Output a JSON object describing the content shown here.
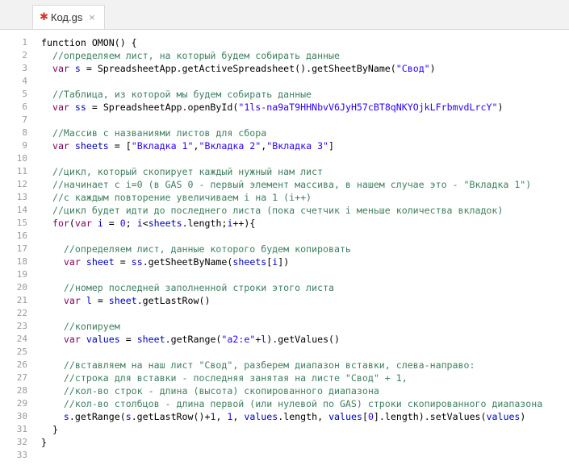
{
  "tab": {
    "modified_marker": "✱",
    "title": "Код.gs",
    "close_label": "×"
  },
  "line_numbers": [
    "1",
    "2",
    "3",
    "4",
    "5",
    "6",
    "7",
    "8",
    "9",
    "10",
    "11",
    "12",
    "13",
    "14",
    "15",
    "16",
    "17",
    "18",
    "19",
    "20",
    "21",
    "22",
    "23",
    "24",
    "25",
    "26",
    "27",
    "28",
    "29",
    "30",
    "31",
    "32",
    "33"
  ],
  "code": [
    [
      {
        "t": "function OMON() {",
        "c": "f"
      }
    ],
    [
      {
        "t": "  //определяем лист, на который будем собирать данные",
        "c": "c"
      }
    ],
    [
      {
        "t": "  ",
        "c": "f"
      },
      {
        "t": "var",
        "c": "k"
      },
      {
        "t": " ",
        "c": "f"
      },
      {
        "t": "s",
        "c": "v"
      },
      {
        "t": " = SpreadsheetApp.getActiveSpreadsheet().getSheetByName(",
        "c": "f"
      },
      {
        "t": "\"Свод\"",
        "c": "s"
      },
      {
        "t": ")",
        "c": "f"
      }
    ],
    [
      {
        "t": "",
        "c": "f"
      }
    ],
    [
      {
        "t": "  //Таблица, из которой мы будем собирать данные",
        "c": "c"
      }
    ],
    [
      {
        "t": "  ",
        "c": "f"
      },
      {
        "t": "var",
        "c": "k"
      },
      {
        "t": " ",
        "c": "f"
      },
      {
        "t": "ss",
        "c": "v"
      },
      {
        "t": " = SpreadsheetApp.openById(",
        "c": "f"
      },
      {
        "t": "\"1ls-na9aT9HHNbvV6JyH57cBT8qNKYOjkLFrbmvdLrcY\"",
        "c": "s"
      },
      {
        "t": ")",
        "c": "f"
      }
    ],
    [
      {
        "t": "",
        "c": "f"
      }
    ],
    [
      {
        "t": "  //Массив с названиями листов для сбора",
        "c": "c"
      }
    ],
    [
      {
        "t": "  ",
        "c": "f"
      },
      {
        "t": "var",
        "c": "k"
      },
      {
        "t": " ",
        "c": "f"
      },
      {
        "t": "sheets",
        "c": "v"
      },
      {
        "t": " = [",
        "c": "f"
      },
      {
        "t": "\"Вкладка 1\"",
        "c": "s"
      },
      {
        "t": ",",
        "c": "f"
      },
      {
        "t": "\"Вкладка 2\"",
        "c": "s"
      },
      {
        "t": ",",
        "c": "f"
      },
      {
        "t": "\"Вкладка 3\"",
        "c": "s"
      },
      {
        "t": "]",
        "c": "f"
      }
    ],
    [
      {
        "t": "",
        "c": "f"
      }
    ],
    [
      {
        "t": "  //цикл, который скопирует каждый нужный нам лист",
        "c": "c"
      }
    ],
    [
      {
        "t": "  //начинает с i=0 (в GAS 0 - первый элемент массива, в нашем случае это - \"Вкладка 1\")",
        "c": "c"
      }
    ],
    [
      {
        "t": "  //с каждым повторение увеличиваем i на 1 (i++)",
        "c": "c"
      }
    ],
    [
      {
        "t": "  //цикл будет идти до последнего листа (пока счетчик i меньше количества вкладок)",
        "c": "c"
      }
    ],
    [
      {
        "t": "  ",
        "c": "f"
      },
      {
        "t": "for",
        "c": "k"
      },
      {
        "t": "(",
        "c": "f"
      },
      {
        "t": "var",
        "c": "k"
      },
      {
        "t": " ",
        "c": "f"
      },
      {
        "t": "i",
        "c": "v"
      },
      {
        "t": " = ",
        "c": "f"
      },
      {
        "t": "0",
        "c": "s"
      },
      {
        "t": "; ",
        "c": "f"
      },
      {
        "t": "i",
        "c": "v"
      },
      {
        "t": "<",
        "c": "f"
      },
      {
        "t": "sheets",
        "c": "v"
      },
      {
        "t": ".length;",
        "c": "f"
      },
      {
        "t": "i",
        "c": "v"
      },
      {
        "t": "++){",
        "c": "f"
      }
    ],
    [
      {
        "t": "",
        "c": "f"
      }
    ],
    [
      {
        "t": "    //определяем лист, данные которого будем копировать",
        "c": "c"
      }
    ],
    [
      {
        "t": "    ",
        "c": "f"
      },
      {
        "t": "var",
        "c": "k"
      },
      {
        "t": " ",
        "c": "f"
      },
      {
        "t": "sheet",
        "c": "v"
      },
      {
        "t": " = ",
        "c": "f"
      },
      {
        "t": "ss",
        "c": "v"
      },
      {
        "t": ".getSheetByName(",
        "c": "f"
      },
      {
        "t": "sheets",
        "c": "v"
      },
      {
        "t": "[",
        "c": "f"
      },
      {
        "t": "i",
        "c": "v"
      },
      {
        "t": "])",
        "c": "f"
      }
    ],
    [
      {
        "t": "",
        "c": "f"
      }
    ],
    [
      {
        "t": "    //номер последней заполненной строки этого листа",
        "c": "c"
      }
    ],
    [
      {
        "t": "    ",
        "c": "f"
      },
      {
        "t": "var",
        "c": "k"
      },
      {
        "t": " ",
        "c": "f"
      },
      {
        "t": "l",
        "c": "v"
      },
      {
        "t": " = ",
        "c": "f"
      },
      {
        "t": "sheet",
        "c": "v"
      },
      {
        "t": ".getLastRow()",
        "c": "f"
      }
    ],
    [
      {
        "t": "",
        "c": "f"
      }
    ],
    [
      {
        "t": "    //копируем",
        "c": "c"
      }
    ],
    [
      {
        "t": "    ",
        "c": "f"
      },
      {
        "t": "var",
        "c": "k"
      },
      {
        "t": " ",
        "c": "f"
      },
      {
        "t": "values",
        "c": "v"
      },
      {
        "t": " = ",
        "c": "f"
      },
      {
        "t": "sheet",
        "c": "v"
      },
      {
        "t": ".getRange(",
        "c": "f"
      },
      {
        "t": "\"a2:e\"",
        "c": "s"
      },
      {
        "t": "+",
        "c": "f"
      },
      {
        "t": "l",
        "c": "v"
      },
      {
        "t": ").getValues()",
        "c": "f"
      }
    ],
    [
      {
        "t": "",
        "c": "f"
      }
    ],
    [
      {
        "t": "    //вставляем на наш лист \"Свод\", разберем диапазон вставки, слева-направо:",
        "c": "c"
      }
    ],
    [
      {
        "t": "    //строка для вставки - последняя занятая на листе \"Свод\" + 1,",
        "c": "c"
      }
    ],
    [
      {
        "t": "    //кол-во строк - длина (высота) скопированного диапазона",
        "c": "c"
      }
    ],
    [
      {
        "t": "    //кол-во столбцов - длина первой (или нулевой по GAS) строки скопированного диапазона",
        "c": "c"
      }
    ],
    [
      {
        "t": "    ",
        "c": "f"
      },
      {
        "t": "s",
        "c": "v"
      },
      {
        "t": ".getRange(",
        "c": "f"
      },
      {
        "t": "s",
        "c": "v"
      },
      {
        "t": ".getLastRow()+",
        "c": "f"
      },
      {
        "t": "1",
        "c": "s"
      },
      {
        "t": ", ",
        "c": "f"
      },
      {
        "t": "1",
        "c": "s"
      },
      {
        "t": ", ",
        "c": "f"
      },
      {
        "t": "values",
        "c": "v"
      },
      {
        "t": ".length, ",
        "c": "f"
      },
      {
        "t": "values",
        "c": "v"
      },
      {
        "t": "[",
        "c": "f"
      },
      {
        "t": "0",
        "c": "s"
      },
      {
        "t": "].length).setValues(",
        "c": "f"
      },
      {
        "t": "values",
        "c": "v"
      },
      {
        "t": ")",
        "c": "f"
      }
    ],
    [
      {
        "t": "  }",
        "c": "f"
      }
    ],
    [
      {
        "t": "}",
        "c": "f"
      }
    ],
    [
      {
        "t": "",
        "c": "f"
      }
    ]
  ]
}
